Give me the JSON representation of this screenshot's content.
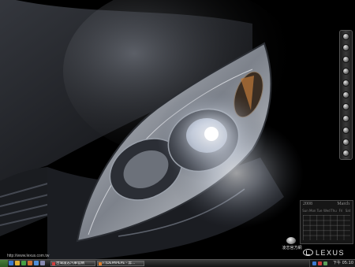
{
  "desktop": {
    "wallpaper_subject": "car-headlight-wallpaper",
    "url_caption": "http://www.lexus.com.tw",
    "dock_icons": [
      "gear-icon",
      "gear-icon",
      "gear-icon",
      "gear-icon",
      "gear-icon",
      "gear-icon",
      "gear-icon",
      "gear-icon",
      "gear-icon",
      "gear-icon",
      "gear-icon"
    ],
    "calendar": {
      "year": "2008",
      "month": "March",
      "weekdays": [
        "Sun",
        "Mon",
        "Tue",
        "Wed",
        "Thu",
        "Fri",
        "Sat"
      ]
    },
    "brand_gadget_label": "凌志官方網",
    "logo_text": "LEXUS"
  },
  "taskbar": {
    "tasks": [
      {
        "label": "台灣凌志汽車官網"
      },
      {
        "label": "F:\\DEPAPEPE - 奔..."
      }
    ],
    "clock": "下午 05:10"
  },
  "colors": {
    "taskbar": "#1f1f1f",
    "start": "#3a6f2e",
    "logo": "#e6e6e6"
  }
}
